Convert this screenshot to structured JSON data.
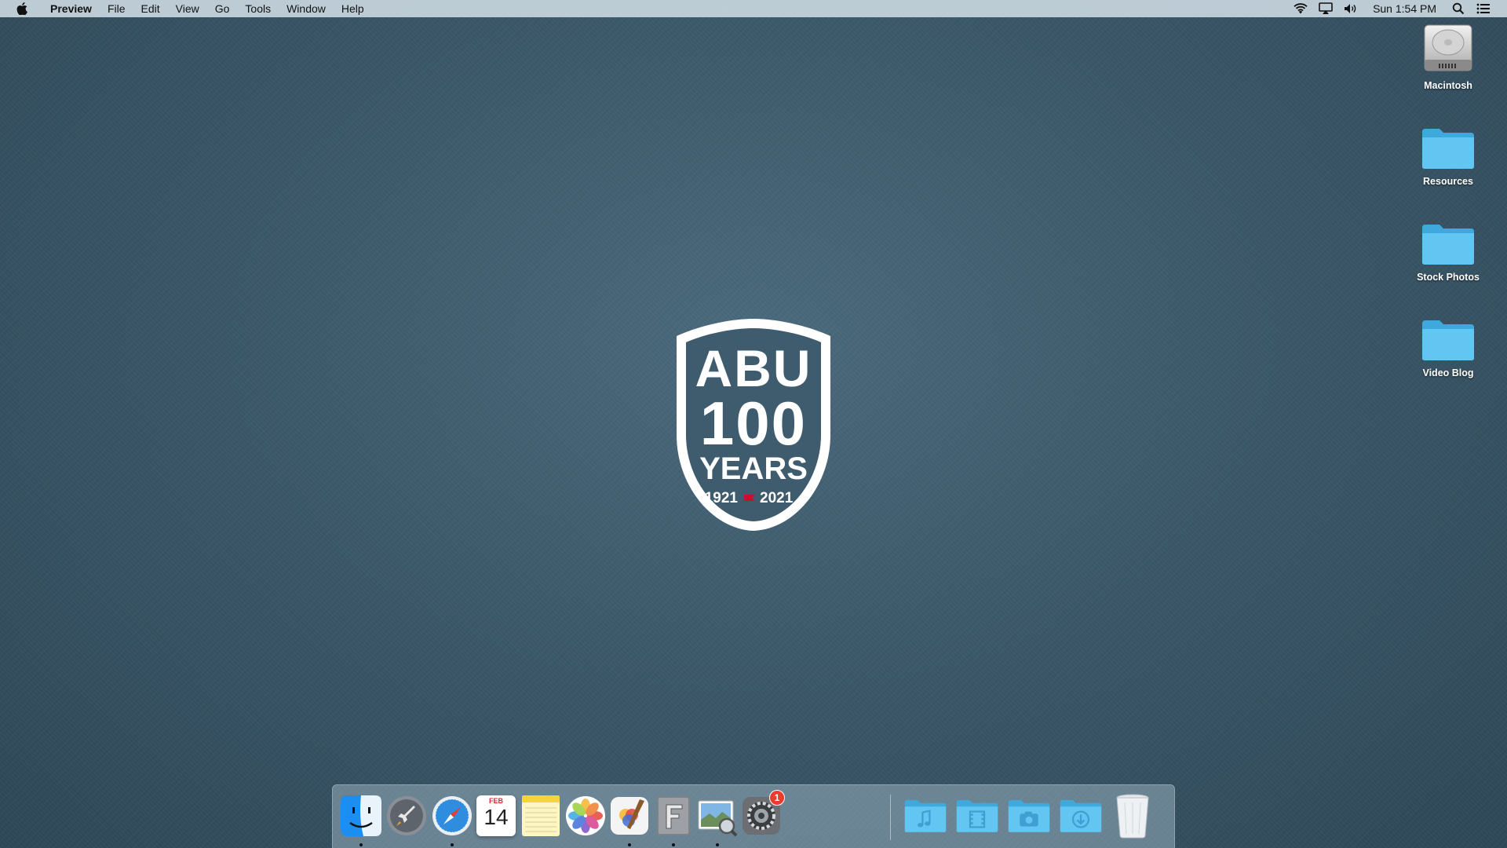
{
  "menubar": {
    "app_name": "Preview",
    "menus": [
      "File",
      "Edit",
      "View",
      "Go",
      "Tools",
      "Window",
      "Help"
    ],
    "clock": "Sun 1:54 PM",
    "status_icons": [
      "wifi-icon",
      "airplay-icon",
      "volume-icon",
      "spotlight-icon",
      "notification-center-icon"
    ]
  },
  "desktop": {
    "icons": [
      {
        "label": "Macintosh",
        "icon": "hard-drive-icon"
      },
      {
        "label": "Resources",
        "icon": "folder-icon"
      },
      {
        "label": "Stock Photos",
        "icon": "folder-icon"
      },
      {
        "label": "Video Blog",
        "icon": "folder-icon"
      }
    ],
    "wallpaper_logo": {
      "line1": "ABU",
      "line2": "100",
      "line3": "YEARS",
      "year_start": "1921",
      "year_end": "2021"
    }
  },
  "dock": {
    "calendar": {
      "month": "FEB",
      "day": "14"
    },
    "system_preferences_badge": "1",
    "apps": [
      {
        "name": "Finder",
        "icon": "finder-icon",
        "running": true
      },
      {
        "name": "Launchpad",
        "icon": "launchpad-icon",
        "running": false
      },
      {
        "name": "Safari",
        "icon": "safari-icon",
        "running": true
      },
      {
        "name": "Calendar",
        "icon": "calendar-icon",
        "running": false
      },
      {
        "name": "Notes",
        "icon": "notes-icon",
        "running": false
      },
      {
        "name": "Photos",
        "icon": "photos-icon",
        "running": false
      },
      {
        "name": "Pixelmator",
        "icon": "pixelmator-icon",
        "running": true
      },
      {
        "name": "Font Book",
        "icon": "font-book-icon",
        "running": true
      },
      {
        "name": "Preview",
        "icon": "preview-icon",
        "running": true
      },
      {
        "name": "System Preferences",
        "icon": "system-preferences-icon",
        "running": false
      }
    ],
    "stacks": [
      {
        "name": "Music",
        "icon": "music-folder-icon"
      },
      {
        "name": "Movies",
        "icon": "movies-folder-icon"
      },
      {
        "name": "Pictures",
        "icon": "pictures-folder-icon"
      },
      {
        "name": "Downloads",
        "icon": "downloads-folder-icon"
      },
      {
        "name": "Trash",
        "icon": "trash-icon"
      }
    ]
  },
  "colors": {
    "wallpaper": "#3b5869",
    "folder": "#5ec3ef",
    "badge": "#ea3b2e",
    "logo_accent": "#c8102e"
  }
}
